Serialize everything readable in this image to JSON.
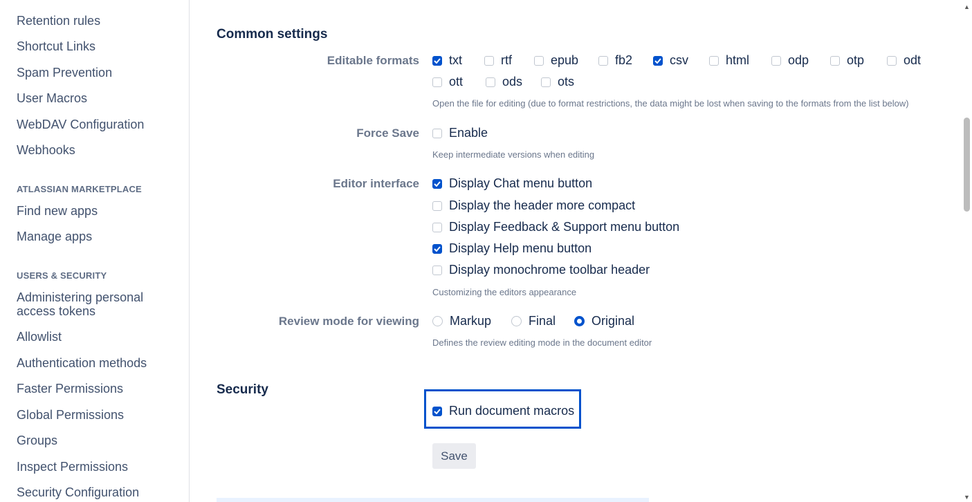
{
  "sidebar": {
    "items_top": [
      "Retention rules",
      "Shortcut Links",
      "Spam Prevention",
      "User Macros",
      "WebDAV Configuration",
      "Webhooks"
    ],
    "marketplace_heading": "ATLASSIAN MARKETPLACE",
    "marketplace_items": [
      "Find new apps",
      "Manage apps"
    ],
    "security_heading": "USERS & SECURITY",
    "security_items": [
      "Administering personal access tokens",
      "Allowlist",
      "Authentication methods",
      "Faster Permissions",
      "Global Permissions",
      "Groups",
      "Inspect Permissions",
      "Security Configuration"
    ]
  },
  "common": {
    "title": "Common settings",
    "editable_formats": {
      "label": "Editable formats",
      "options": [
        {
          "label": "txt",
          "checked": true
        },
        {
          "label": "rtf",
          "checked": false
        },
        {
          "label": "epub",
          "checked": false
        },
        {
          "label": "fb2",
          "checked": false
        },
        {
          "label": "csv",
          "checked": true
        },
        {
          "label": "html",
          "checked": false
        },
        {
          "label": "odp",
          "checked": false
        },
        {
          "label": "otp",
          "checked": false
        },
        {
          "label": "odt",
          "checked": false
        },
        {
          "label": "ott",
          "checked": false
        },
        {
          "label": "ods",
          "checked": false
        },
        {
          "label": "ots",
          "checked": false
        }
      ],
      "help": "Open the file for editing (due to format restrictions, the data might be lost when saving to the formats from the list below)"
    },
    "force_save": {
      "label": "Force Save",
      "option": {
        "label": "Enable",
        "checked": false
      },
      "help": "Keep intermediate versions when editing"
    },
    "editor_interface": {
      "label": "Editor interface",
      "options": [
        {
          "label": "Display Chat menu button",
          "checked": true
        },
        {
          "label": "Display the header more compact",
          "checked": false
        },
        {
          "label": "Display Feedback & Support menu button",
          "checked": false
        },
        {
          "label": "Display Help menu button",
          "checked": true
        },
        {
          "label": "Display monochrome toolbar header",
          "checked": false
        }
      ],
      "help": "Customizing the editors appearance"
    },
    "review_mode": {
      "label": "Review mode for viewing",
      "options": [
        {
          "label": "Markup",
          "selected": false
        },
        {
          "label": "Final",
          "selected": false
        },
        {
          "label": "Original",
          "selected": true
        }
      ],
      "help": "Defines the review editing mode in the document editor"
    }
  },
  "security": {
    "title": "Security",
    "run_macros": {
      "label": "Run document macros",
      "checked": true
    }
  },
  "save_label": "Save",
  "colors": {
    "accent": "#0052cc",
    "text": "#172b4d",
    "muted": "#6b778c"
  }
}
